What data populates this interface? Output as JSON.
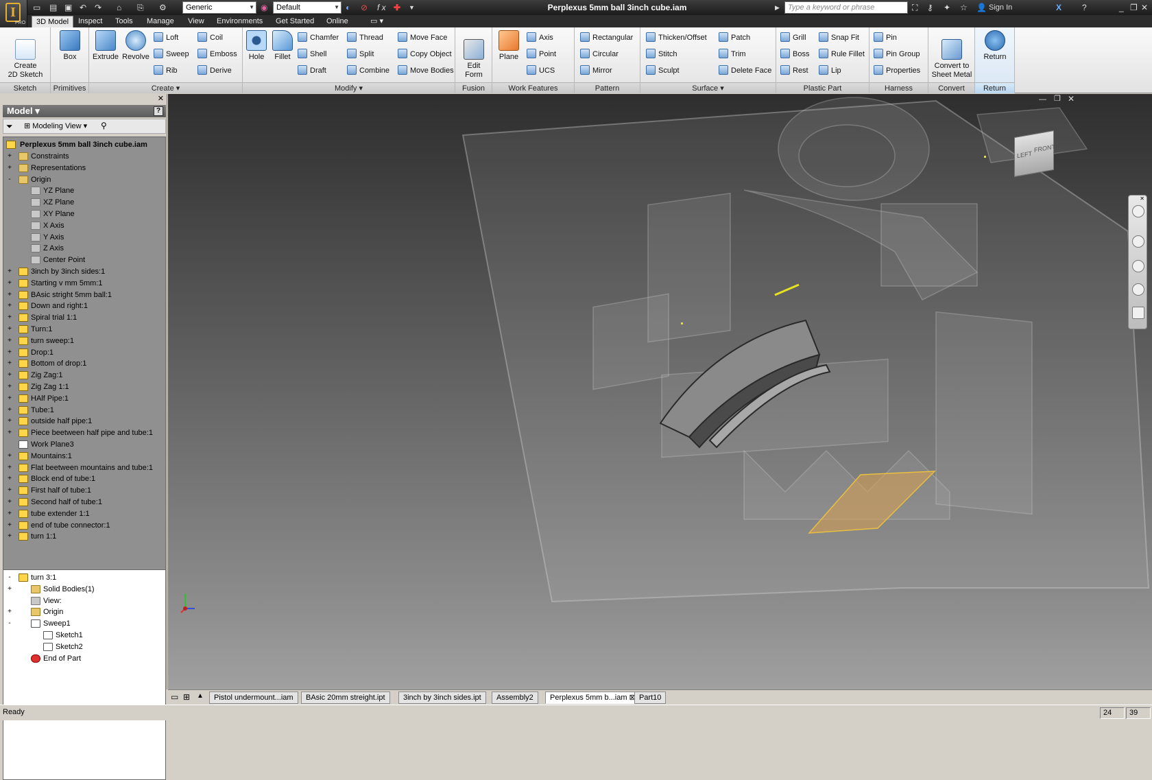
{
  "window": {
    "title": "Perplexus 5mm ball 3inch cube.iam"
  },
  "app": {
    "logo": "I",
    "edition": "PRO"
  },
  "quick_access": {
    "material": "Generic",
    "appearance": "Default",
    "fx": "f x"
  },
  "search": {
    "placeholder": "Type a keyword or phrase"
  },
  "help_bar": {
    "sign_in": "Sign In"
  },
  "ribbon_tabs": [
    "3D Model",
    "Inspect",
    "Tools",
    "Manage",
    "View",
    "Environments",
    "Get Started",
    "Online"
  ],
  "ribbon": {
    "sketch": {
      "label": "Sketch",
      "create": "Create\n2D Sketch"
    },
    "primitives": {
      "label": "Primitives",
      "box": "Box"
    },
    "create": {
      "label": "Create",
      "extrude": "Extrude",
      "revolve": "Revolve",
      "loft": "Loft",
      "sweep": "Sweep",
      "rib": "Rib",
      "coil": "Coil",
      "emboss": "Emboss",
      "derive": "Derive"
    },
    "modify": {
      "label": "Modify",
      "hole": "Hole",
      "fillet": "Fillet",
      "chamfer": "Chamfer",
      "shell": "Shell",
      "draft": "Draft",
      "thread": "Thread",
      "split": "Split",
      "combine": "Combine",
      "move_face": "Move Face",
      "copy_object": "Copy Object",
      "move_bodies": "Move Bodies"
    },
    "fusion": {
      "label": "Fusion",
      "edit_form": "Edit\nForm"
    },
    "work_features": {
      "label": "Work Features",
      "plane": "Plane",
      "axis": "Axis",
      "point": "Point",
      "ucs": "UCS"
    },
    "pattern": {
      "label": "Pattern",
      "rectangular": "Rectangular",
      "circular": "Circular",
      "mirror": "Mirror"
    },
    "surface": {
      "label": "Surface",
      "thicken": "Thicken/Offset",
      "stitch": "Stitch",
      "sculpt": "Sculpt",
      "patch": "Patch",
      "trim": "Trim",
      "delete_face": "Delete Face"
    },
    "plastic_part": {
      "label": "Plastic Part",
      "grill": "Grill",
      "boss": "Boss",
      "rest": "Rest",
      "snap_fit": "Snap Fit",
      "rule_fillet": "Rule Fillet",
      "lip": "Lip"
    },
    "harness": {
      "label": "Harness",
      "pin": "Pin",
      "pin_group": "Pin Group",
      "properties": "Properties"
    },
    "convert": {
      "label": "Convert",
      "sheet_metal": "Convert to\nSheet Metal"
    },
    "return": {
      "label": "Return",
      "return": "Return"
    }
  },
  "browser": {
    "title": "Model",
    "view_mode": "Modeling View",
    "root": "Perplexus 5mm ball 3inch cube.iam",
    "nodes": [
      {
        "label": "Constraints",
        "icon": "folder-icon",
        "indent": 0,
        "exp": "+"
      },
      {
        "label": "Representations",
        "icon": "representations-icon",
        "indent": 0,
        "exp": "+"
      },
      {
        "label": "Origin",
        "icon": "folder-icon",
        "indent": 0,
        "exp": "-"
      },
      {
        "label": "YZ Plane",
        "icon": "plane-icon",
        "indent": 1,
        "exp": ""
      },
      {
        "label": "XZ Plane",
        "icon": "plane-icon",
        "indent": 1,
        "exp": ""
      },
      {
        "label": "XY Plane",
        "icon": "plane-icon",
        "indent": 1,
        "exp": ""
      },
      {
        "label": "X Axis",
        "icon": "axis-icon",
        "indent": 1,
        "exp": ""
      },
      {
        "label": "Y Axis",
        "icon": "axis-icon",
        "indent": 1,
        "exp": ""
      },
      {
        "label": "Z Axis",
        "icon": "axis-icon",
        "indent": 1,
        "exp": ""
      },
      {
        "label": "Center Point",
        "icon": "point-icon",
        "indent": 1,
        "exp": ""
      },
      {
        "label": "3inch by 3inch sides:1",
        "icon": "part-icon",
        "indent": 0,
        "exp": "+"
      },
      {
        "label": "Starting v mm 5mm:1",
        "icon": "part-icon",
        "indent": 0,
        "exp": "+"
      },
      {
        "label": "BAsic stright 5mm ball:1",
        "icon": "part-icon",
        "indent": 0,
        "exp": "+"
      },
      {
        "label": "Down and right:1",
        "icon": "part-icon",
        "indent": 0,
        "exp": "+"
      },
      {
        "label": "Spiral trial 1:1",
        "icon": "part-icon",
        "indent": 0,
        "exp": "+"
      },
      {
        "label": "Turn:1",
        "icon": "part-icon",
        "indent": 0,
        "exp": "+"
      },
      {
        "label": "turn sweep:1",
        "icon": "part-icon",
        "indent": 0,
        "exp": "+"
      },
      {
        "label": "Drop:1",
        "icon": "part-icon",
        "indent": 0,
        "exp": "+"
      },
      {
        "label": "Bottom of drop:1",
        "icon": "part-icon",
        "indent": 0,
        "exp": "+"
      },
      {
        "label": "Zig Zag:1",
        "icon": "part-icon",
        "indent": 0,
        "exp": "+"
      },
      {
        "label": "Zig Zag 1:1",
        "icon": "part-icon",
        "indent": 0,
        "exp": "+"
      },
      {
        "label": "HAlf Pipe:1",
        "icon": "part-icon",
        "indent": 0,
        "exp": "+"
      },
      {
        "label": "Tube:1",
        "icon": "part-icon",
        "indent": 0,
        "exp": "+"
      },
      {
        "label": "outside half pipe:1",
        "icon": "part-icon",
        "indent": 0,
        "exp": "+"
      },
      {
        "label": "Piece beetween half pipe and tube:1",
        "icon": "part-icon",
        "indent": 0,
        "exp": "+"
      },
      {
        "label": "Work Plane3",
        "icon": "workplane-icon",
        "indent": 0,
        "exp": ""
      },
      {
        "label": "Mountains:1",
        "icon": "part-icon",
        "indent": 0,
        "exp": "+"
      },
      {
        "label": "Flat beetween mountains and tube:1",
        "icon": "part-icon",
        "indent": 0,
        "exp": "+"
      },
      {
        "label": "Block end of tube:1",
        "icon": "part-icon",
        "indent": 0,
        "exp": "+"
      },
      {
        "label": "First half of tube:1",
        "icon": "part-icon",
        "indent": 0,
        "exp": "+"
      },
      {
        "label": "Second half of tube:1",
        "icon": "part-icon",
        "indent": 0,
        "exp": "+"
      },
      {
        "label": "tube extender 1:1",
        "icon": "part-icon",
        "indent": 0,
        "exp": "+"
      },
      {
        "label": "end of tube connector:1",
        "icon": "part-icon",
        "indent": 0,
        "exp": "+"
      },
      {
        "label": "turn 1:1",
        "icon": "part-icon",
        "indent": 0,
        "exp": "+"
      }
    ],
    "active_nodes": [
      {
        "label": "turn 3:1",
        "icon": "part-icon",
        "indent": 0,
        "exp": "-"
      },
      {
        "label": "Solid Bodies(1)",
        "icon": "folder-icon",
        "indent": 1,
        "exp": "+"
      },
      {
        "label": "View:",
        "icon": "view-icon",
        "indent": 1,
        "exp": ""
      },
      {
        "label": "Origin",
        "icon": "folder-icon",
        "indent": 1,
        "exp": "+"
      },
      {
        "label": "Sweep1",
        "icon": "sweep-icon",
        "indent": 1,
        "exp": "-"
      },
      {
        "label": "Sketch1",
        "icon": "sketch-icon",
        "indent": 2,
        "exp": ""
      },
      {
        "label": "Sketch2",
        "icon": "sketch-icon",
        "indent": 2,
        "exp": ""
      },
      {
        "label": "End of Part",
        "icon": "end-of-part-icon",
        "indent": 1,
        "exp": ""
      }
    ]
  },
  "viewcube": {
    "left": "LEFT",
    "front": "FRONT"
  },
  "doc_tabs": [
    "Pistol undermount...iam",
    "BAsic 20mm streight.ipt",
    "3inch by 3inch sides.ipt",
    "Assembly2",
    "Perplexus 5mm b...iam",
    "Part10"
  ],
  "active_doc": "Perplexus 5mm b...iam",
  "status": {
    "text": "Ready",
    "count1": "24",
    "count2": "39"
  },
  "colors": {
    "ribbon_bg": "#ececec",
    "browser_grey": "#909090",
    "selection_plane": "#d8a050",
    "highlight": "#e8e020"
  }
}
